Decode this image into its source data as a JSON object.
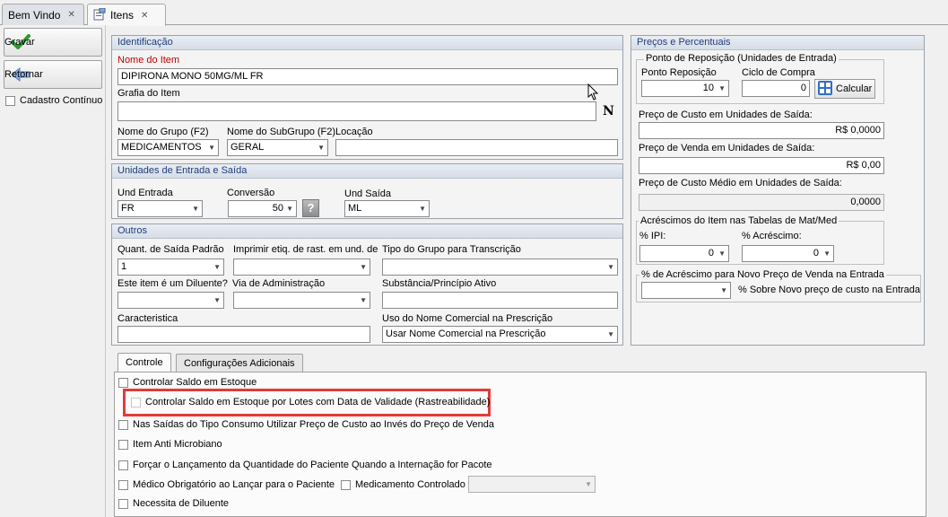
{
  "tabs": [
    {
      "label": "Bem Vindo",
      "close": "✕"
    },
    {
      "label": "Itens",
      "close": "✕"
    }
  ],
  "toolbar": {
    "save_label": "Gravar",
    "back_label": "Retornar",
    "continuous_label": "Cadastro Contínuo"
  },
  "identificacao": {
    "title": "Identificação",
    "nome_label": "Nome do Item",
    "nome_value": "DIPIRONA MONO 50MG/ML FR",
    "grafia_label": "Grafia do Item",
    "grafia_value": "",
    "grafia_button": "N",
    "grupo_label": "Nome do Grupo (F2)",
    "grupo_value": "MEDICAMENTOS",
    "subgrupo_label": "Nome do SubGrupo (F2)",
    "subgrupo_value": "GERAL",
    "locacao_label": "Locação",
    "locacao_value": ""
  },
  "unidades": {
    "title": "Unidades de Entrada e Saída",
    "entrada_label": "Und Entrada",
    "entrada_value": "FR",
    "conversao_label": "Conversão",
    "conversao_value": "50",
    "help_label": "?",
    "saida_label": "Und Saída",
    "saida_value": "ML"
  },
  "outros": {
    "title": "Outros",
    "quant_label": "Quant. de Saída Padrão",
    "quant_value": "1",
    "imprimir_label": "Imprimir etiq. de rast. em und. de",
    "imprimir_value": "",
    "tipo_grupo_label": "Tipo do Grupo para Transcrição",
    "tipo_grupo_value": "",
    "diluente_label": "Este item é um Diluente?",
    "diluente_value": "",
    "via_label": "Via de Administração",
    "via_value": "",
    "substancia_label": "Substância/Princípio Ativo",
    "substancia_value": "",
    "caracteristica_label": "Caracteristica",
    "caracteristica_value": "",
    "uso_label": "Uso do Nome Comercial na Prescrição",
    "uso_value": "Usar Nome Comercial na Prescrição"
  },
  "precos": {
    "title": "Preços e Percentuais",
    "reposicao_title": "Ponto de Reposição (Unidades de Entrada)",
    "ponto_label": "Ponto Reposição",
    "ponto_value": "10",
    "ciclo_label": "Ciclo de Compra",
    "ciclo_value": "0",
    "calcular_label": "Calcular",
    "custo_label": "Preço de Custo em Unidades de Saída:",
    "custo_value": "R$ 0,0000",
    "venda_label": "Preço de Venda em Unidades de Saída:",
    "venda_value": "R$ 0,00",
    "medio_label": "Preço de Custo Médio em Unidades de Saída:",
    "medio_value": "0,0000",
    "acrescimos_title": "Acréscimos do Item nas Tabelas de Mat/Med",
    "ipi_label": "% IPI:",
    "ipi_value": "0",
    "acrescimo_label": "% Acréscimo:",
    "acrescimo_value": "0",
    "novo_preco_title": "% de Acréscimo para Novo Preço de Venda na Entrada",
    "novo_preco_value": "",
    "sobre_label": "% Sobre Novo preço de custo na Entrada"
  },
  "bottom_tabs": [
    "Controle",
    "Configurações Adicionais"
  ],
  "controle": {
    "saldo": "Controlar Saldo em Estoque",
    "lotes": "Controlar Saldo em Estoque por Lotes com Data de Validade (Rastreabilidade)",
    "consumo": "Nas Saídas do Tipo Consumo Utilizar Preço de Custo ao Invés do Preço de Venda",
    "antimicrobiano": "Item Anti Microbiano",
    "forcar": "Forçar o Lançamento da Quantidade do Paciente Quando a Internação for Pacote",
    "medico": "Médico Obrigatório ao Lançar para o Paciente",
    "controlado": "Medicamento Controlado",
    "controlado_value": "",
    "necessita": "Necessita de Diluente"
  },
  "colors": {
    "accent": "#1f3d7a",
    "highlight": "#e23b3b",
    "required_label": "#c00000"
  }
}
